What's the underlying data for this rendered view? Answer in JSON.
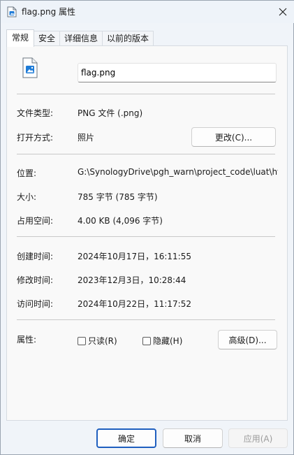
{
  "window": {
    "title": "flag.png 属性"
  },
  "tabs": [
    {
      "label": "常规",
      "active": true
    },
    {
      "label": "安全",
      "active": false
    },
    {
      "label": "详细信息",
      "active": false
    },
    {
      "label": "以前的版本",
      "active": false
    }
  ],
  "general": {
    "file_name": "flag.png",
    "file_type_label": "文件类型:",
    "file_type_value": "PNG 文件 (.png)",
    "opens_with_label": "打开方式:",
    "opens_with_value": "照片",
    "change_button": "更改(C)...",
    "location_label": "位置:",
    "location_value": "G:\\SynologyDrive\\pgh_warn\\project_code\\luat\\htt",
    "size_label": "大小:",
    "size_value": "785 字节 (785 字节)",
    "size_on_disk_label": "占用空间:",
    "size_on_disk_value": "4.00 KB (4,096 字节)",
    "created_label": "创建时间:",
    "created_value": "2024年10月17日，16:11:55",
    "modified_label": "修改时间:",
    "modified_value": "2023年12月3日，10:28:44",
    "accessed_label": "访问时间:",
    "accessed_value": "2024年10月22日，11:17:52",
    "attributes_label": "属性:",
    "readonly_label": "只读(R)",
    "hidden_label": "隐藏(H)",
    "advanced_button": "高级(D)..."
  },
  "footer": {
    "ok": "确定",
    "cancel": "取消",
    "apply": "应用(A)"
  },
  "colors": {
    "accent": "#1f5fbf",
    "panel": "#f9f9f9",
    "window": "#f0f4f9"
  },
  "icons": {
    "title": "image-file-icon",
    "close": "close-icon",
    "file": "image-file-icon"
  }
}
